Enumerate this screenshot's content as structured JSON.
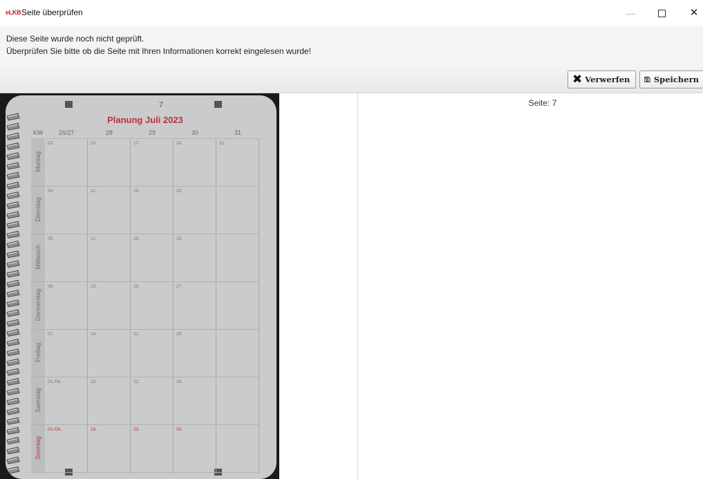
{
  "window": {
    "logo_text": "eLKB",
    "title": "Seite überprüfen",
    "controls": [
      "minimize",
      "maximize",
      "close"
    ]
  },
  "info": {
    "line1": "Diese Seite wurde noch nicht geprüft.",
    "line2": "Überprüfen Sie bitte ob die Seite mit Ihren Informationen korrekt eingelesen wurde!"
  },
  "toolbar": {
    "discard_label": "Verwerfen",
    "save_label": "Speichern"
  },
  "right_pane": {
    "page_label": "Seite: 7"
  },
  "scan": {
    "page_number": "7",
    "title": "Planung Juli 2023",
    "kw_header": "KW",
    "weeks": [
      "26/27",
      "28",
      "29",
      "30",
      "31"
    ],
    "days": [
      {
        "name": "Montag",
        "dates": [
          "03.",
          "10.",
          "17.",
          "24.",
          "31."
        ]
      },
      {
        "name": "Dienstag",
        "dates": [
          "04.",
          "11.",
          "18.",
          "25.",
          ""
        ]
      },
      {
        "name": "Mittwoch",
        "dates": [
          "05.",
          "12.",
          "19.",
          "26.",
          ""
        ]
      },
      {
        "name": "Donnerstag",
        "dates": [
          "06.",
          "13.",
          "20.",
          "27.",
          ""
        ]
      },
      {
        "name": "Freitag",
        "dates": [
          "07.",
          "14.",
          "21.",
          "28.",
          ""
        ]
      },
      {
        "name": "Samstag",
        "dates": [
          "01./08.",
          "15.",
          "22.",
          "29.",
          ""
        ]
      },
      {
        "name": "Sonntag",
        "dates": [
          "02./09.",
          "16.",
          "23.",
          "30.",
          ""
        ],
        "highlight": "red"
      }
    ],
    "colors": {
      "title": "#c0303a",
      "sunday": "#c0303a"
    }
  }
}
